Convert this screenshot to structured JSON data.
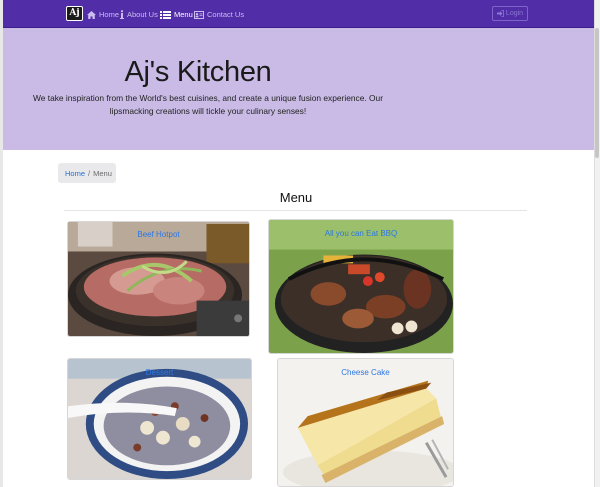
{
  "navbar": {
    "brand": "Aj",
    "items": [
      {
        "label": "Home",
        "icon": "home-icon"
      },
      {
        "label": "About Us",
        "icon": "info-icon"
      },
      {
        "label": "Menu",
        "icon": "list-icon"
      },
      {
        "label": "Contact Us",
        "icon": "address-card-icon"
      }
    ],
    "login_label": "Login",
    "bg_color": "#512da8"
  },
  "jumbotron": {
    "title": "Aj's Kitchen",
    "tagline": "We take inspiration from the World's best cuisines, and create a unique fusion experience. Our lipsmacking creations will tickle your culinary senses!",
    "bg_color": "#c9bbe5"
  },
  "breadcrumb": {
    "home": "Home",
    "separator": "/",
    "current": "Menu"
  },
  "main": {
    "heading": "Menu",
    "dishes": [
      {
        "name": "Beef Hotpot"
      },
      {
        "name": "All you can Eat BBQ"
      },
      {
        "name": "Dessert"
      },
      {
        "name": "Cheese Cake"
      }
    ]
  }
}
